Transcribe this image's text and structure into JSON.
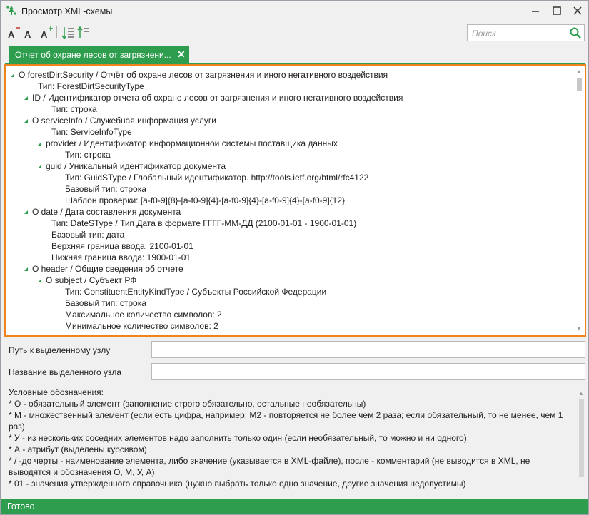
{
  "window": {
    "title": "Просмотр XML-схемы",
    "accent": "#2e9e4e",
    "highlight": "#f0841c"
  },
  "toolbar": {
    "font_decrease": "A",
    "font_reset": "A",
    "font_increase": "A",
    "icons": [
      "font-decrease-icon",
      "font-reset-icon",
      "font-increase-icon",
      "expand-all-icon",
      "collapse-all-icon"
    ]
  },
  "search": {
    "placeholder": "Поиск"
  },
  "tab": {
    "label": "Отчет об охране лесов от загрязнени...",
    "close": "✕"
  },
  "tree": {
    "rows": [
      {
        "text": "О forestDirtSecurity / Отчёт об охране лесов от загрязнения и иного негативного воздействия",
        "level": 0,
        "expander": true
      },
      {
        "text": "Тип: ForestDirtSecurityType",
        "level": 1,
        "expander": false
      },
      {
        "text": "ID / Идентификатор отчета об охране лесов от загрязнения и иного негативного воздействия",
        "level": 1,
        "expander": true
      },
      {
        "text": "Тип: строка",
        "level": 2,
        "expander": false
      },
      {
        "text": "О serviceInfo / Служебная информация услуги",
        "level": 1,
        "expander": true
      },
      {
        "text": "Тип: ServiceInfoType",
        "level": 2,
        "expander": false
      },
      {
        "text": "provider / Идентификатор информационной системы поставщика данных",
        "level": 2,
        "expander": true
      },
      {
        "text": "Тип: строка",
        "level": 3,
        "expander": false
      },
      {
        "text": "guid / Уникальный идентификатор документа",
        "level": 2,
        "expander": true
      },
      {
        "text": "Тип: GuidSType / Глобальный идентификатор. http://tools.ietf.org/html/rfc4122",
        "level": 3,
        "expander": false
      },
      {
        "text": "Базовый тип: строка",
        "level": 3,
        "expander": false
      },
      {
        "text": "Шаблон проверки: [a-f0-9]{8}-[a-f0-9]{4}-[a-f0-9]{4}-[a-f0-9]{4}-[a-f0-9]{12}",
        "level": 3,
        "expander": false
      },
      {
        "text": "О date / Дата составления документа",
        "level": 1,
        "expander": true
      },
      {
        "text": "Тип: DateSType / Тип Дата в формате ГГГГ-ММ-ДД (2100-01-01 - 1900-01-01)",
        "level": 2,
        "expander": false
      },
      {
        "text": "Базовый тип: дата",
        "level": 2,
        "expander": false
      },
      {
        "text": "Верхняя граница ввода: 2100-01-01",
        "level": 2,
        "expander": false
      },
      {
        "text": "Нижняя граница ввода: 1900-01-01",
        "level": 2,
        "expander": false
      },
      {
        "text": "О header / Общие сведения об отчете",
        "level": 1,
        "expander": true
      },
      {
        "text": "О subject / Субъект РФ",
        "level": 2,
        "expander": true
      },
      {
        "text": "Тип: ConstituentEntityKindType / Субъекты Российской Федерации",
        "level": 3,
        "expander": false
      },
      {
        "text": "Базовый тип: строка",
        "level": 3,
        "expander": false
      },
      {
        "text": "Максимальное количество символов: 2",
        "level": 3,
        "expander": false
      },
      {
        "text": "Минимальное количество символов: 2",
        "level": 3,
        "expander": false
      }
    ]
  },
  "fields": {
    "path_label": "Путь к выделенному узлу",
    "path_value": "",
    "name_label": "Название выделенного узла",
    "name_value": ""
  },
  "legend": {
    "lines": [
      "Условные обозначения:",
      "* О - обязательный элемент (заполнение строго обязательно, остальные необязательны)",
      "* М - множественный элемент (если есть цифра, например: М2 - повторяется не более чем 2 раза; если обязательный, то не менее, чем 1 раз)",
      "* У - из нескольких соседних элементов надо заполнить только один (если необязательный, то можно и ни одного)",
      "* А - атрибут (выделены курсивом)",
      "* / -до черты - наименование элемента, либо значение (указывается в XML-файле), после - комментарий (не выводится в XML, не выводятся и обозначения О, М, У, А)",
      "* 01 - значения утвержденного справочника (нужно выбрать только одно значение, другие значения недопустимы)"
    ]
  },
  "status": {
    "text": "Готово"
  }
}
